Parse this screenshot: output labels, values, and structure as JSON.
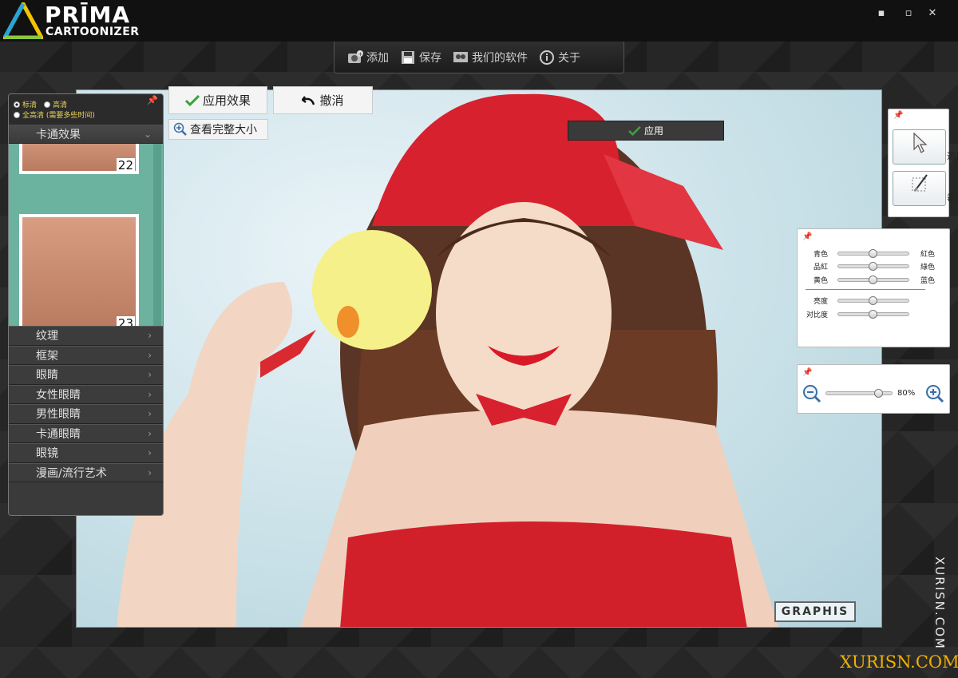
{
  "app": {
    "logo_name": "PRĪMA",
    "logo_sub": "CARTOONIZER"
  },
  "window": {
    "minimize": "▪",
    "maximize": "▫",
    "close": "✕"
  },
  "toolbar": {
    "items": [
      {
        "label": "添加",
        "icon": "add-image-icon"
      },
      {
        "label": "保存",
        "icon": "save-icon"
      },
      {
        "label": "我们的软件",
        "icon": "software-icon"
      },
      {
        "label": "关于",
        "icon": "info-icon"
      }
    ]
  },
  "actions": {
    "apply_effect": "应用效果",
    "undo": "撤消",
    "view_full": "查看完整大小",
    "apply": "应用"
  },
  "left_panel": {
    "quality": {
      "standard": "标清",
      "high": "高清",
      "full": "全高清 (需要多些时间)"
    },
    "section_title": "卡通效果",
    "thumbnails": [
      {
        "num": "22"
      },
      {
        "num": "23"
      }
    ],
    "categories": [
      "纹理",
      "框架",
      "眼睛",
      "女性眼睛",
      "男性眼睛",
      "卡通眼睛",
      "眼镜",
      "漫画/流行艺术"
    ]
  },
  "tools": {
    "select": "选择",
    "crop": "裁剪"
  },
  "color_panel": {
    "rows": [
      {
        "left": "青色",
        "right": "紅色",
        "value": 0.5
      },
      {
        "left": "品紅",
        "right": "綠色",
        "value": 0.5
      },
      {
        "left": "黄色",
        "right": "蓝色",
        "value": 0.5
      }
    ],
    "tone_rows": [
      {
        "left": "亮度",
        "value": 0.5
      },
      {
        "left": "对比度",
        "value": 0.5
      }
    ]
  },
  "zoom": {
    "value": "80%",
    "level": 0.8
  },
  "image": {
    "watermark": "GRAPHIS"
  },
  "site_watermark": {
    "vertical": "XURISN.COM",
    "horizontal": "XURISN.COM"
  }
}
